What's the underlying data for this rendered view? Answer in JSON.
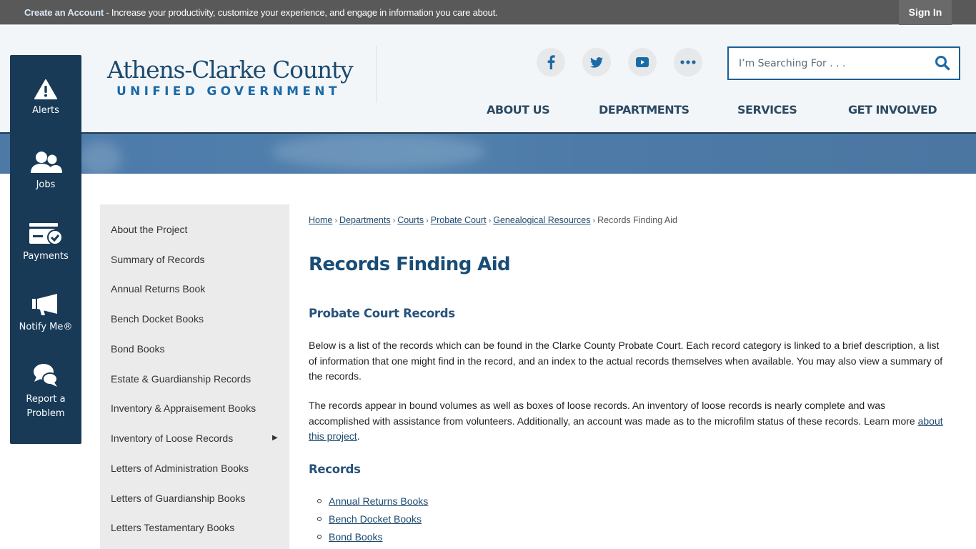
{
  "topbar": {
    "create_account_label": "Create an Account",
    "message": " - Increase your productivity, customize your experience, and engage in information you care about.",
    "sign_in_label": "Sign In"
  },
  "header": {
    "logo_line1": "Athens-Clarke County",
    "logo_line2": "UNIFIED GOVERNMENT",
    "social": [
      {
        "name": "facebook-icon",
        "label": "Facebook"
      },
      {
        "name": "twitter-icon",
        "label": "Twitter"
      },
      {
        "name": "youtube-icon",
        "label": "YouTube"
      },
      {
        "name": "more-icon",
        "label": "More"
      }
    ],
    "search": {
      "placeholder": "I’m Searching For . . .",
      "value": ""
    },
    "nav": [
      "ABOUT US",
      "DEPARTMENTS",
      "SERVICES",
      "GET INVOLVED"
    ]
  },
  "colors": {
    "brand_dark": "#183a57",
    "heading_blue": "#1a4d76",
    "link_blue": "#1d4a70",
    "accent_blue": "#1b6aa8",
    "topbar_gray": "#595959"
  },
  "quick_links": [
    {
      "icon": "alert-icon",
      "label": "Alerts"
    },
    {
      "icon": "jobs-icon",
      "label": "Jobs"
    },
    {
      "icon": "payments-icon",
      "label": "Payments"
    },
    {
      "icon": "megaphone-icon",
      "label": "Notify Me®"
    },
    {
      "icon": "chat-icon",
      "label_line1": "Report a",
      "label_line2": "Problem"
    }
  ],
  "subnav": [
    "About the Project",
    "Summary of Records",
    "Annual Returns Book",
    "Bench Docket Books",
    "Bond Books",
    "Estate & Guardianship Records",
    "Inventory & Appraisement Books",
    "Inventory of Loose Records",
    "Letters of Administration Books",
    "Letters of Guardianship Books",
    "Letters Testamentary Books"
  ],
  "subnav_arrow": "▶",
  "breadcrumb": {
    "links": [
      "Home",
      "Departments",
      "Courts",
      "Probate Court",
      "Genealogical Resources"
    ],
    "current": "Records Finding Aid",
    "separator": "›"
  },
  "content": {
    "title": "Records Finding Aid",
    "section1_heading": "Probate Court Records",
    "para1": "Below is a list of the records which can be found in the Clarke County Probate Court. Each record category is linked to a brief description, a list of information that one might find in the record, and an index to the actual records themselves when available. You may also view a summary of the records.",
    "para2_text": "The records appear in bound volumes as well as boxes of loose records. An inventory of loose records is nearly complete and was accomplished with assistance from volunteers. Additionally, an account was made as to the microfilm status of these records. Learn more ",
    "para2_link": "about this project",
    "para2_end": ".",
    "section2_heading": "Records",
    "records": [
      "Annual Returns Books",
      "Bench Docket Books",
      "Bond Books"
    ]
  }
}
